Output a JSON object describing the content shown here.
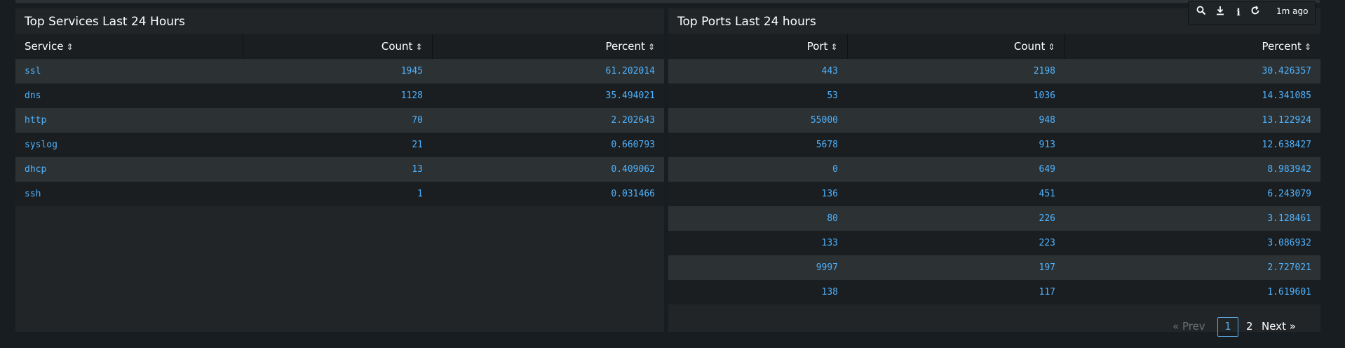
{
  "left_panel": {
    "title": "Top Services Last 24 Hours",
    "columns": [
      "Service",
      "Count",
      "Percent"
    ],
    "rows": [
      [
        "ssl",
        "1945",
        "61.202014"
      ],
      [
        "dns",
        "1128",
        "35.494021"
      ],
      [
        "http",
        "70",
        "2.202643"
      ],
      [
        "syslog",
        "21",
        "0.660793"
      ],
      [
        "dhcp",
        "13",
        "0.409062"
      ],
      [
        "ssh",
        "1",
        "0.031466"
      ]
    ]
  },
  "right_panel": {
    "title": "Top Ports Last 24 hours",
    "columns": [
      "Port",
      "Count",
      "Percent"
    ],
    "rows": [
      [
        "443",
        "2198",
        "30.426357"
      ],
      [
        "53",
        "1036",
        "14.341085"
      ],
      [
        "55000",
        "948",
        "13.122924"
      ],
      [
        "5678",
        "913",
        "12.638427"
      ],
      [
        "0",
        "649",
        "8.983942"
      ],
      [
        "136",
        "451",
        "6.243079"
      ],
      [
        "80",
        "226",
        "3.128461"
      ],
      [
        "133",
        "223",
        "3.086932"
      ],
      [
        "9997",
        "197",
        "2.727021"
      ],
      [
        "138",
        "117",
        "1.619601"
      ]
    ],
    "pagination": {
      "prev": "« Prev",
      "pages": [
        "1",
        "2"
      ],
      "current": "1",
      "next": "Next »"
    }
  },
  "toolbar": {
    "icons": [
      "search-icon",
      "download-icon",
      "info-icon",
      "refresh-icon"
    ],
    "updated": "1m ago"
  },
  "colors": {
    "background": "#171d21",
    "panel": "#212527",
    "link": "#4fb3ff",
    "row_alt": "#2c3133"
  }
}
